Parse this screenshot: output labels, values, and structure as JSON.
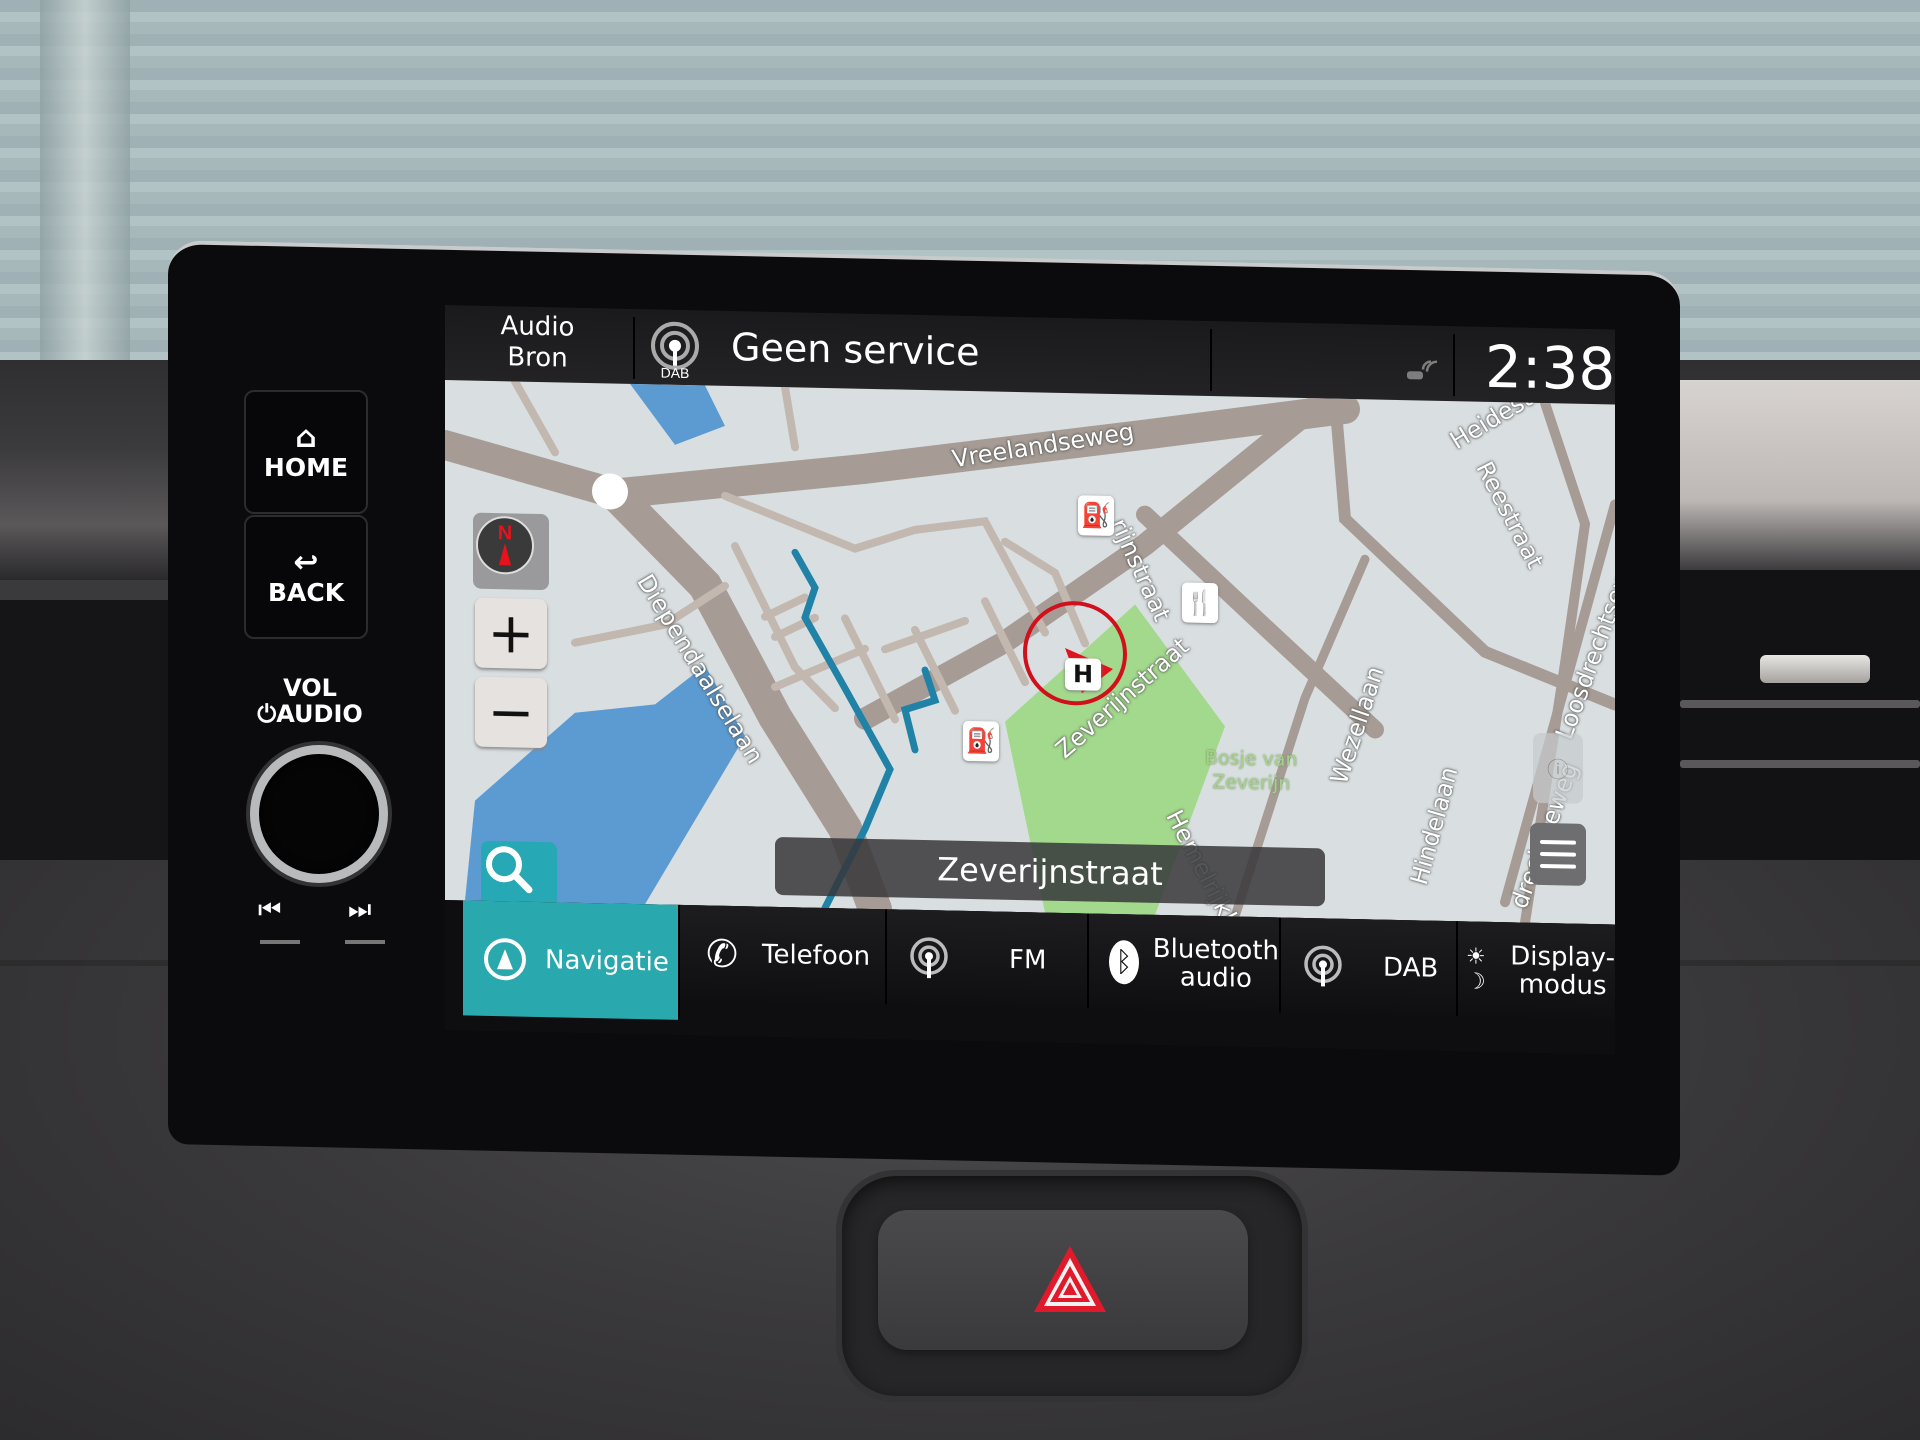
{
  "hardware": {
    "home_label": "HOME",
    "back_label": "BACK",
    "vol_label": "VOL",
    "audio_label": "AUDIO",
    "prev_label": "⏮",
    "next_label": "⏭"
  },
  "status_bar": {
    "audio_source_line1": "Audio",
    "audio_source_line2": "Bron",
    "dab_icon_label": "DAB",
    "station_text": "Geen service",
    "clock": "2:38"
  },
  "map": {
    "current_street": "Zeverijnstraat",
    "zoom_in_label": "+",
    "zoom_out_label": "−",
    "compass_label": "N",
    "streets": [
      {
        "name": "Vreelandseweg"
      },
      {
        "name": "Diependaalselaan"
      },
      {
        "name": "Zeverijnstraat"
      },
      {
        "name": "Zeverijnstraat (side)",
        "short": "rijnstraat"
      },
      {
        "name": "Heidestraat",
        "short": "Heidestra"
      },
      {
        "name": "Reestraat"
      },
      {
        "name": "Wezellaan"
      },
      {
        "name": "Hindelaan"
      },
      {
        "name": "Hemelrijklaan",
        "short": "Hemelrijkla"
      },
      {
        "name": "Loosdrechtseweg"
      },
      {
        "name": "Loosdrechtseweg (lower)",
        "short": "drechtseweg"
      }
    ],
    "park_name_line1": "Bosje van",
    "park_name_line2": "Zeverijn",
    "poi": {
      "fuel": "⛽",
      "restaurant": "🍴",
      "dealer": "H"
    },
    "colors": {
      "background": "#d9dfe1",
      "road": "#a69c95",
      "route": "#1f82a6",
      "water": "#5b9bd2",
      "park": "#a3d98c",
      "position_marker": "#e0141e"
    }
  },
  "bottom_nav": {
    "tabs": [
      {
        "label": "Navigatie",
        "icon": "navigation-icon",
        "active": true
      },
      {
        "label": "Telefoon",
        "icon": "phone-icon",
        "active": false
      },
      {
        "label": "FM",
        "icon": "radio-icon",
        "active": false
      },
      {
        "label_line1": "Bluetooth",
        "label_line2": "audio",
        "icon": "bluetooth-icon",
        "active": false
      },
      {
        "label": "DAB",
        "icon": "radio-icon",
        "active": false
      },
      {
        "label_line1": "Display-",
        "label_line2": "modus",
        "icon": "day-night-icon",
        "active": false
      }
    ],
    "accent_color": "#29a8ad"
  },
  "display_mode_icon": "☀☽"
}
